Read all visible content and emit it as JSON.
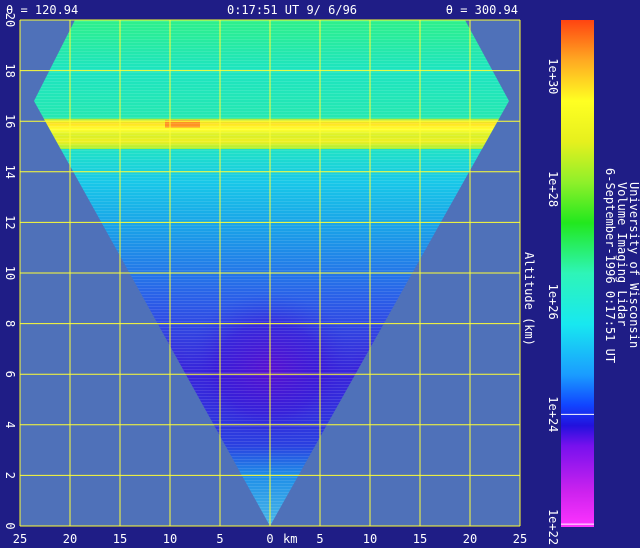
{
  "header": {
    "theta_left": "θ = 120.94",
    "time": "0:17:51 UT  9/ 6/96",
    "theta_right": "θ = 300.94"
  },
  "chart_data": {
    "type": "heatmap",
    "title": "",
    "xlabel": "km",
    "ylabel": "Altitude (km)",
    "xlim": [
      -25,
      25
    ],
    "ylim": [
      0,
      20
    ],
    "x_ticks": [
      -25,
      -20,
      -15,
      -10,
      -5,
      0,
      5,
      10,
      15,
      20,
      25
    ],
    "x_tick_labels": [
      "25",
      "20",
      "15",
      "10",
      "5",
      "0",
      "5",
      "10",
      "15",
      "20",
      "25"
    ],
    "y_ticks": [
      0,
      2,
      4,
      6,
      8,
      10,
      12,
      14,
      16,
      18,
      20
    ],
    "y_tick_labels": [
      "0",
      "2",
      "4",
      "6",
      "8",
      "10",
      "12",
      "14",
      "16",
      "18",
      "20"
    ],
    "grid": true,
    "scan_wedge_km": [
      [
        0,
        0
      ],
      [
        -23.6,
        16.8
      ],
      [
        -19.5,
        20
      ],
      [
        19.5,
        20
      ],
      [
        23.9,
        16.8
      ]
    ],
    "cirrus_layer_altitude_km": [
      14.9,
      16.1
    ],
    "colorbar": {
      "scale": "log",
      "range_exponent": [
        22,
        31
      ],
      "tick_exponents": [
        22,
        24,
        26,
        28,
        30
      ],
      "tick_labels": [
        "1e+22",
        "1e+24",
        "1e+26",
        "1e+28",
        "1e+30"
      ]
    },
    "colors": {
      "background": "#1f1d86",
      "plot_area": "#4f71b9",
      "grid": "#ffff33",
      "annotation": "#ffffff"
    }
  },
  "caption": {
    "line1": "University of Wisconsin",
    "line2": "Volume Imaging Lidar",
    "line3": "6-September-1996  0:17:51 UT"
  }
}
